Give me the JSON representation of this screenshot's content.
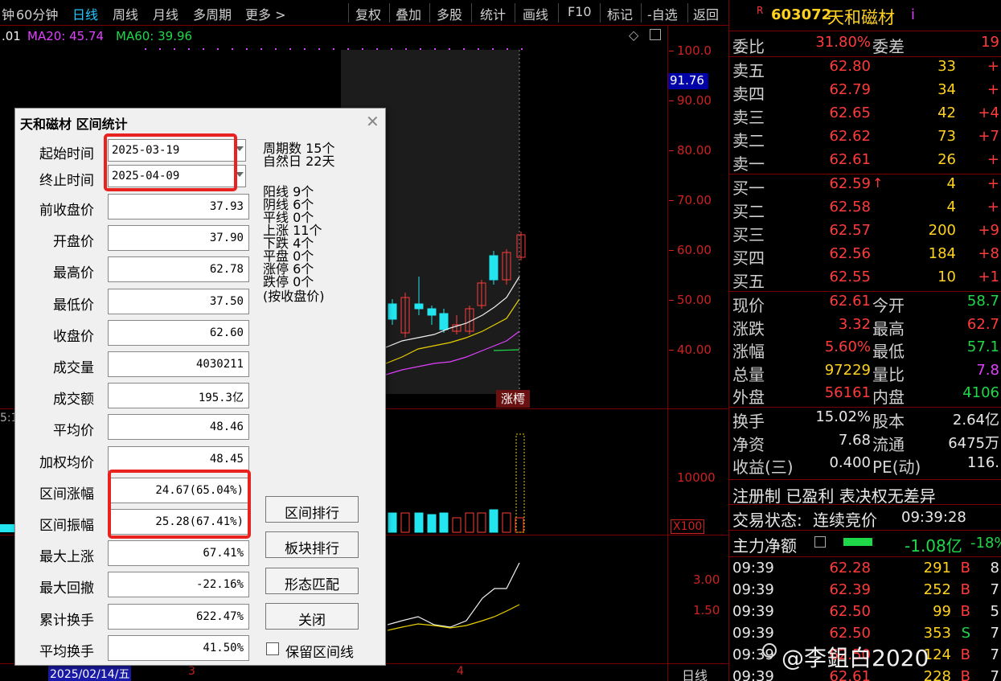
{
  "toolbar": {
    "items": [
      "钟",
      "60分钟",
      "日线",
      "周线",
      "月线",
      "多周期",
      "更多 >",
      "复权",
      "叠加",
      "多股",
      "统计",
      "画线",
      "F10",
      "标记",
      "-自选",
      "返回"
    ]
  },
  "indicators": {
    "ma_prefix": ".01",
    "ma20": "MA20: 45.74",
    "ma60": "MA60: 39.96"
  },
  "price_axis": [
    "100.0",
    "90.00",
    "80.00",
    "70.00",
    "60.00",
    "50.00",
    "40.00"
  ],
  "current_price_tag": "91.76",
  "limit_up_tag": "涨樗",
  "volume_axis": [
    "10000",
    "X100"
  ],
  "indicator_axis": [
    "3.00",
    "1.50"
  ],
  "left_axis_label": "5:1",
  "bottom_bar": {
    "date": "2025/02/14/五",
    "m3": "3",
    "m4": "4",
    "period": "日线"
  },
  "watermark": "@李鉏白2020",
  "quote": {
    "code_prefix": "R",
    "code": "603072",
    "name": "天和磁材",
    "name_suffix": "i",
    "weibi_label": "委比",
    "weibi_value": "31.80%",
    "weicha_label": "委差",
    "weicha_value": "19",
    "asks": [
      {
        "label": "卖五",
        "price": "62.80",
        "vol": "33",
        "chg": "+"
      },
      {
        "label": "卖四",
        "price": "62.79",
        "vol": "34",
        "chg": "+"
      },
      {
        "label": "卖三",
        "price": "62.65",
        "vol": "42",
        "chg": "+4"
      },
      {
        "label": "卖二",
        "price": "62.62",
        "vol": "73",
        "chg": "+7"
      },
      {
        "label": "卖一",
        "price": "62.61",
        "vol": "26",
        "chg": "+"
      }
    ],
    "bids": [
      {
        "label": "买一",
        "price": "62.59",
        "vol": "4",
        "chg": "+"
      },
      {
        "label": "买二",
        "price": "62.58",
        "vol": "4",
        "chg": "+"
      },
      {
        "label": "买三",
        "price": "62.57",
        "vol": "200",
        "chg": "+9"
      },
      {
        "label": "买四",
        "price": "62.56",
        "vol": "184",
        "chg": "+8"
      },
      {
        "label": "买五",
        "price": "62.55",
        "vol": "10",
        "chg": "+1"
      }
    ],
    "stats1": [
      {
        "l1": "现价",
        "v1": "62.61",
        "l2": "今开",
        "v2": "58.7"
      },
      {
        "l1": "涨跌",
        "v1": "3.32",
        "l2": "最高",
        "v2": "62.7"
      },
      {
        "l1": "涨幅",
        "v1": "5.60%",
        "l2": "最低",
        "v2": "57.1"
      },
      {
        "l1": "总量",
        "v1": "97229",
        "l2": "量比",
        "v2": "7.8"
      },
      {
        "l1": "外盘",
        "v1": "56161",
        "l2": "内盘",
        "v2": "4106"
      }
    ],
    "stats2": [
      {
        "l1": "换手",
        "v1": "15.02%",
        "l2": "股本",
        "v2": "2.64亿"
      },
      {
        "l1": "净资",
        "v1": "7.68",
        "l2": "流通",
        "v2": "6475万"
      },
      {
        "l1": "收益(三)",
        "v1": "0.400",
        "l2": "PE(动)",
        "v2": "116."
      }
    ],
    "tags": "注册制 已盈利 表决权无差异",
    "trade_status_label": "交易状态:",
    "trade_status": "连续竞价",
    "trade_time": "09:39:28",
    "main_flow_label": "主力净额",
    "main_flow_value": "-1.08亿",
    "main_flow_pct": "-18%",
    "ticks": [
      {
        "time": "09:39",
        "price": "62.28",
        "vol": "291",
        "bs": "B",
        "n": "8"
      },
      {
        "time": "09:39",
        "price": "62.39",
        "vol": "252",
        "bs": "B",
        "n": "7"
      },
      {
        "time": "09:39",
        "price": "62.50",
        "vol": "99",
        "bs": "B",
        "n": "5"
      },
      {
        "time": "09:39",
        "price": "62.50",
        "vol": "353",
        "bs": "S",
        "n": "7"
      },
      {
        "time": "09:39",
        "price": "62.50",
        "vol": "124",
        "bs": "B",
        "n": "7"
      },
      {
        "time": "09:39",
        "price": "62.61",
        "vol": "228",
        "bs": "B",
        "n": "7"
      }
    ]
  },
  "dialog": {
    "title": "天和磁材 区间统计",
    "start_label": "起始时间",
    "start_value": "2025-03-19",
    "end_label": "终止时间",
    "end_value": "2025-04-09",
    "fields": [
      {
        "label": "前收盘价",
        "value": "37.93"
      },
      {
        "label": "开盘价",
        "value": "37.90"
      },
      {
        "label": "最高价",
        "value": "62.78"
      },
      {
        "label": "最低价",
        "value": "37.50"
      },
      {
        "label": "收盘价",
        "value": "62.60"
      },
      {
        "label": "成交量",
        "value": "4030211"
      },
      {
        "label": "成交额",
        "value": "195.3亿"
      },
      {
        "label": "平均价",
        "value": "48.46"
      },
      {
        "label": "加权均价",
        "value": "48.45"
      },
      {
        "label": "区间涨幅",
        "value": "24.67(65.04%)"
      },
      {
        "label": "区间振幅",
        "value": "25.28(67.41%)"
      },
      {
        "label": "最大上涨",
        "value": "67.41%"
      },
      {
        "label": "最大回撤",
        "value": "-22.16%"
      },
      {
        "label": "累计换手",
        "value": "622.47%"
      },
      {
        "label": "平均换手",
        "value": "41.50%"
      }
    ],
    "stats": [
      "周期数 15个",
      "自然日 22天",
      "阳线 9个",
      "阴线 6个",
      "平线 0个",
      "上涨 11个",
      "下跌 4个",
      "平盘 0个",
      "涨停 6个",
      "跌停 0个",
      "(按收盘价)"
    ],
    "buttons": [
      "区间排行",
      "板块排行",
      "形态匹配",
      "关闭"
    ],
    "keep_line_label": "保留区间线"
  },
  "colors": {
    "up": "#ff3b3b",
    "down": "#22e5f0",
    "ma_yellow": "#e8d000",
    "ma_magenta": "#e040ff",
    "ma_white": "#f0f0f0",
    "grid": "#7a0000"
  }
}
